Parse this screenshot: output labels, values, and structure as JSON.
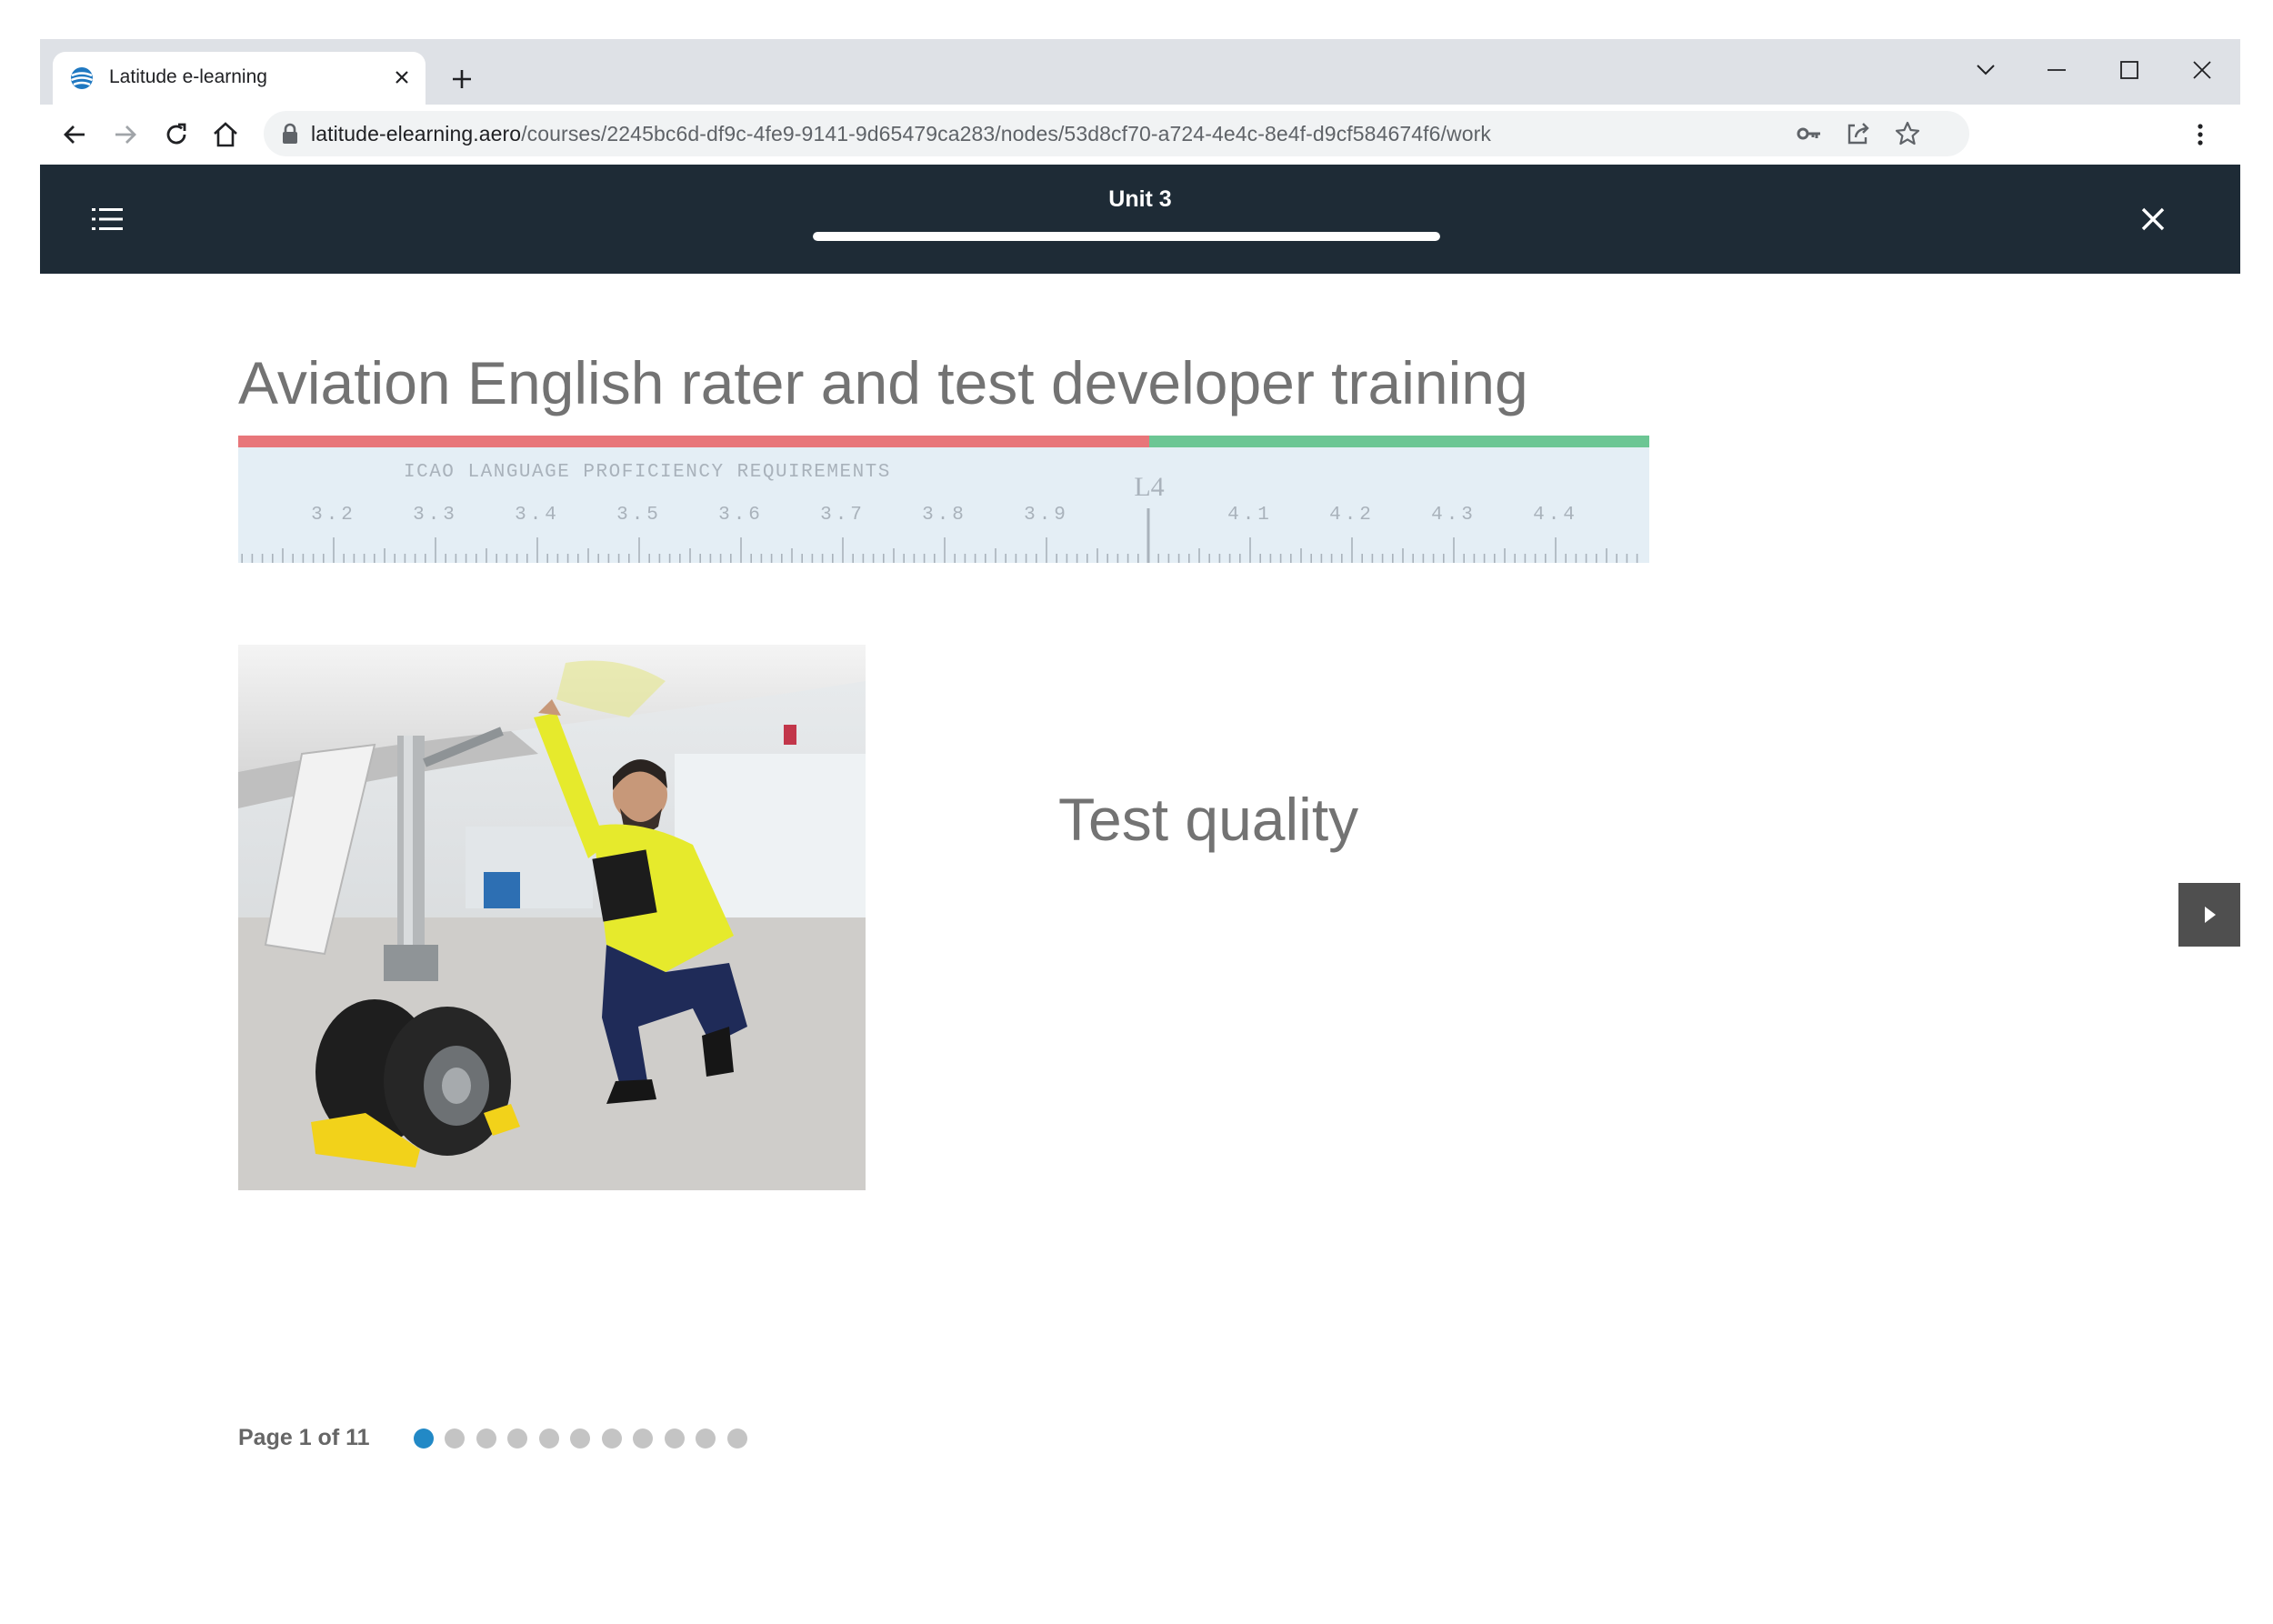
{
  "browser": {
    "tab_title": "Latitude e-learning",
    "url_host": "latitude-elearning.aero",
    "url_path": "/courses/2245bc6d-df9c-4fe9-9141-9d65479ca283/nodes/53d8cf70-a724-4e4c-8e4f-d9cf584674f6/work"
  },
  "header": {
    "unit_title": "Unit 3",
    "progress_fraction": 1.0
  },
  "content": {
    "course_title": "Aviation English rater and test developer training",
    "slide_title": "Test quality",
    "ruler": {
      "heading": "ICAO LANGUAGE PROFICIENCY REQUIREMENTS",
      "marker": "L4",
      "ticks": [
        "3.2",
        "3.3",
        "3.4",
        "3.5",
        "3.6",
        "3.7",
        "3.8",
        "3.9",
        "4.1",
        "4.2",
        "4.3",
        "4.4"
      ],
      "below_color": "#e8767a",
      "above_color": "#6cc694"
    }
  },
  "pager": {
    "label": "Page 1 of 11",
    "total": 11,
    "current": 1,
    "active_color": "#2289c6"
  },
  "icons": {
    "favicon": "latitude-globe-icon",
    "tab_close": "close-icon",
    "new_tab": "plus-icon",
    "back": "arrow-left-icon",
    "forward": "arrow-right-icon",
    "reload": "reload-icon",
    "home": "home-icon",
    "lock": "lock-icon",
    "key": "key-icon",
    "share": "share-icon",
    "bookmark": "star-icon",
    "menu": "hamburger-icon",
    "close_course": "close-icon",
    "next": "play-icon"
  }
}
